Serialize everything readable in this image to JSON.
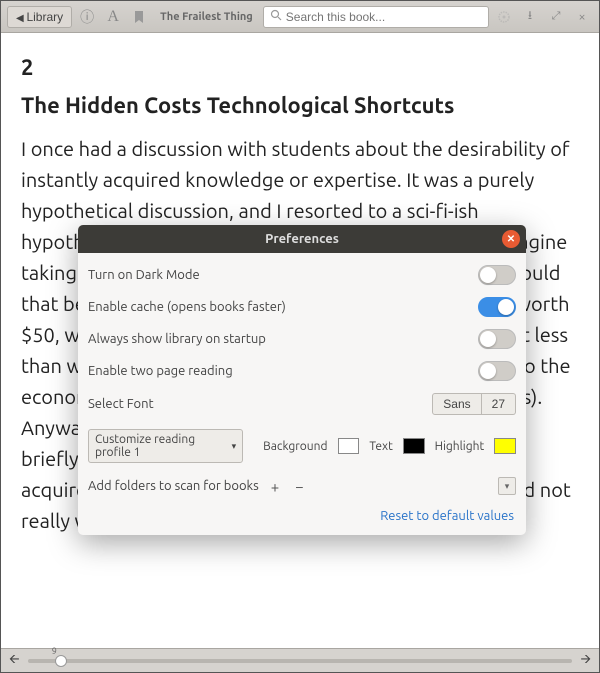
{
  "toolbar": {
    "library_label": "Library",
    "book_title": "The Frailest Thing",
    "search_placeholder": "Search this book..."
  },
  "chapter": {
    "number": "2",
    "title": "The Hidden Costs Technological Shortcuts",
    "body": "I once had a discussion with students about the desirability of instantly acquired knowledge or expertise. It was a purely hypothetical discussion, and I resorted to a sci-fi-ish hypothetical to drive it. Something along these lines: Imagine taking a Matrix-style shortcut to expertise. How much would that be worth to you? Would the contents of a book be worth $50, what about $1,000? The latter, after all, is quite a bit less than what the real thing costs at most institutions (and so the economic rationality of those who would set those prices). Anyway, my argument at the time, and the one I'd like to briefly articulate here, was that even if we were able to acquire knowledge through such a transaction, we should not really want to."
  },
  "footer": {
    "page": "9"
  },
  "prefs": {
    "title": "Preferences",
    "dark_mode": {
      "label": "Turn on Dark Mode",
      "value": false
    },
    "cache": {
      "label": "Enable cache (opens books faster)",
      "value": true
    },
    "startup": {
      "label": "Always show library on startup",
      "value": false
    },
    "two_page": {
      "label": "Enable two page reading",
      "value": false
    },
    "font": {
      "label": "Select Font",
      "name": "Sans",
      "size": "27"
    },
    "profile": {
      "select_label": "Customize reading profile 1",
      "bg_label": "Background",
      "text_label": "Text",
      "hl_label": "Highlight"
    },
    "folders": {
      "label": "Add folders to scan for books"
    },
    "reset": "Reset to default values",
    "colors": {
      "bg": "#ffffff",
      "text": "#000000",
      "highlight": "#ffff00"
    }
  }
}
